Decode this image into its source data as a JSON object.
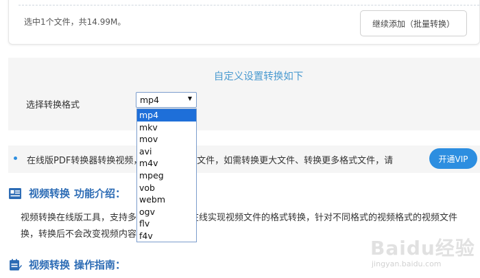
{
  "upload": {
    "status_text": "选中1个文件，共14.99M。",
    "add_button_label": "继续添加（批量转换）"
  },
  "settings": {
    "title": "自定义设置转换如下",
    "format_label": "选择转换格式",
    "selected_format": "mp4",
    "format_options": [
      "mp4",
      "mkv",
      "mov",
      "avi",
      "m4v",
      "mpeg",
      "vob",
      "webm",
      "ogv",
      "flv",
      "f4v"
    ]
  },
  "vip_notice": {
    "text": "在线版PDF转换器转换视频，支持20M以内文件，如需转换更大文件、转换更多格式文件，请",
    "button_label": "开通VIP"
  },
  "intro_section": {
    "title_main": "视频转换",
    "title_sub": "功能介绍：",
    "line1": "视频转换在线版工具，支持多种视频格式，在线实现视频文件的格式转换，针对不同格式的视频格式的视频文件",
    "line2": "换，转换后不会改变视频内容。"
  },
  "guide_section": {
    "title_main": "视频转换",
    "title_sub": "操作指南："
  },
  "watermark": {
    "brand": "Baidu经验",
    "url": "jingyan.baidu.com"
  },
  "colors": {
    "accent_blue": "#2d8ee0",
    "heading_blue": "#2d6cb5",
    "title_blue": "#4a9ad0",
    "selected_option_bg": "#1e6fd9",
    "panel_bg": "#f5f5f5"
  }
}
